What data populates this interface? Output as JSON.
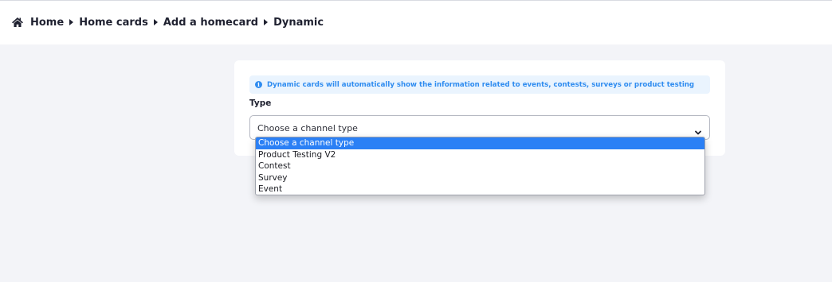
{
  "breadcrumb": {
    "icon": "home-icon",
    "items": [
      "Home",
      "Home cards",
      "Add a homecard",
      "Dynamic"
    ]
  },
  "info": {
    "icon": "info-icon",
    "text": "Dynamic cards will automatically show the information related to events, contests, surveys or product testing"
  },
  "form": {
    "type_label": "Type",
    "select": {
      "selected": "Choose a channel type",
      "chevron_icon": "chevron-down-icon",
      "options": [
        "Choose a channel type",
        "Product Testing V2",
        "Contest",
        "Survey",
        "Event"
      ],
      "highlighted_index": 0
    }
  },
  "colors": {
    "accent": "#2f8cf0",
    "highlight": "#2b80f5",
    "background": "#f3f4f8"
  }
}
